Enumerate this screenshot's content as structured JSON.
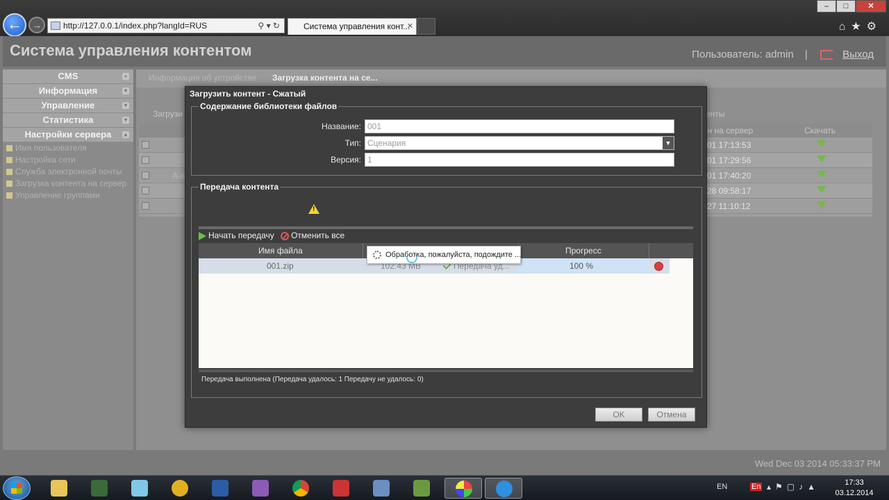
{
  "browser": {
    "address": "http://127.0.0.1/index.php?langId=RUS",
    "tab_title": "Система управления конт...",
    "tab_close": "✕"
  },
  "header": {
    "title": "Система управления контентом",
    "user_label": "Пользователь: admin",
    "separator": "|",
    "logout": "Выход"
  },
  "sidebar": {
    "sections": [
      "CMS",
      "Информация",
      "Управление",
      "Статистика",
      "Настройки сервера"
    ],
    "subitems": [
      "Имя пользователя",
      "Настройка сети",
      "Служба электронной почты",
      "Загрузка контента на сервер",
      "Управление группами"
    ]
  },
  "main": {
    "tabs": [
      "Информация об устройстве",
      "Загрузка контента на се..."
    ],
    "toolbar_label": "Загрузи",
    "toolbar_right": "енты",
    "grid": {
      "col_server": "ен на сервер",
      "col_download": "Скачать",
      "row_name": "A-в",
      "times": [
        "-01 17:13:53",
        "-01 17:29:56",
        "-01 17:40:20",
        "-28 09:58:17",
        "-27 11:10:12"
      ]
    },
    "status_date": "Wed Dec 03 2014 05:33:37 PM"
  },
  "dialog": {
    "title": "Загрузить контент - Сжатый",
    "library": {
      "legend": "Содержание библиотеки файлов",
      "name_label": "Название:",
      "name_value": "001",
      "type_label": "Тип:",
      "type_value": "Сценария",
      "version_label": "Версия:",
      "version_value": "1"
    },
    "transfer": {
      "legend": "Передача контента",
      "start_label": "Начать передачу",
      "cancel_all_label": "Отменить все",
      "col_filename": "Имя файла",
      "col_progress": "Прогресс",
      "file_name": "001.zip",
      "file_size": "102.43 MB",
      "file_status": "Передача уд...",
      "file_progress": "100 %",
      "progress_fraction": 1.0,
      "processing_text": "Обработка, пожалуйста, подождите ...",
      "status_text": "Передача выполнена (Передача удалось: 1   Передачу не удалось: 0)"
    },
    "ok_label": "OK",
    "cancel_label": "Отмена"
  },
  "taskbar": {
    "lang": "EN",
    "lang_badge": "En",
    "time": "17:33",
    "date": "03.12.2014"
  },
  "colors": {
    "accent_green": "#6ac04a",
    "cancel_red": "#e05555",
    "warning_yellow": "#f3d33a"
  }
}
